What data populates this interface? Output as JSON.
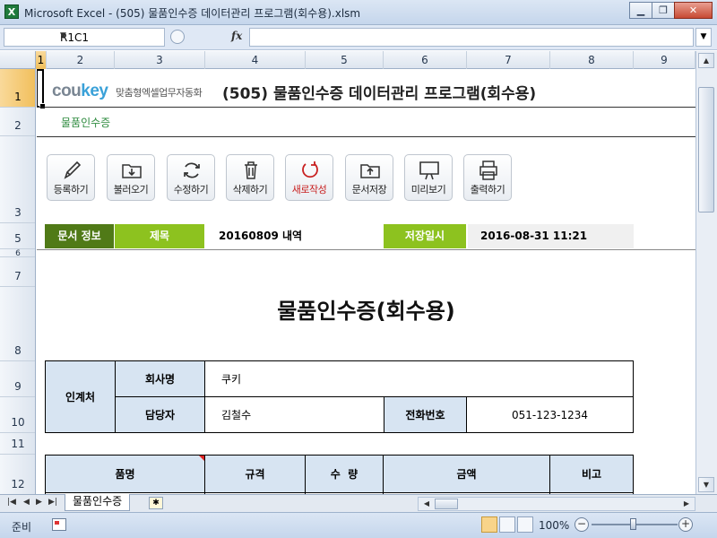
{
  "window": {
    "title": "Microsoft Excel - (505) 물품인수증 데이터관리 프로그램(회수용).xlsm",
    "app_icon": "X"
  },
  "formula_bar": {
    "name_box": "R1C1",
    "fx": "fx",
    "value": ""
  },
  "columns": [
    "1",
    "2",
    "3",
    "4",
    "5",
    "6",
    "7",
    "8",
    "9"
  ],
  "rows": [
    "1",
    "2",
    "3",
    "5",
    "6",
    "7",
    "8",
    "9",
    "10",
    "11",
    "12"
  ],
  "header": {
    "logo_a": "cou",
    "logo_b": "key",
    "tagline": "맞춤형엑셀업무자동화",
    "program_title": "(505) 물품인수증 데이터관리 프로그램(회수용)",
    "sheet_label": "물품인수증"
  },
  "toolbar": [
    {
      "label": "등록하기",
      "icon": "pencil-icon"
    },
    {
      "label": "불러오기",
      "icon": "load-folder-icon"
    },
    {
      "label": "수정하기",
      "icon": "refresh-icon"
    },
    {
      "label": "삭제하기",
      "icon": "trash-icon"
    },
    {
      "label": "새로작성",
      "icon": "new-circle-icon"
    },
    {
      "label": "문서저장",
      "icon": "save-folder-icon"
    },
    {
      "label": "미리보기",
      "icon": "monitor-icon"
    },
    {
      "label": "출력하기",
      "icon": "printer-icon"
    }
  ],
  "info": {
    "doc_info_label": "문서 정보",
    "subject_label": "제목",
    "subject_value": "20160809 내역",
    "saved_label": "저장일시",
    "saved_value": "2016-08-31 11:21"
  },
  "document": {
    "title": "물품인수증(회수용)",
    "receiver_label": "인계처",
    "company_label": "회사명",
    "company_value": "쿠키",
    "manager_label": "담당자",
    "manager_value": "김철수",
    "phone_label": "전화번호",
    "phone_value": "051-123-1234"
  },
  "items_header": [
    "품명",
    "규격",
    "수  량",
    "금액",
    "비고"
  ],
  "sheet_tabs": {
    "active": "물품인수증"
  },
  "status": {
    "ready": "준비",
    "zoom": "100%"
  },
  "colors": {
    "dark_green": "#507a17",
    "light_green": "#8dc21f",
    "header_blue": "#d7e4f2",
    "accent_green": "#2e8b3f"
  }
}
